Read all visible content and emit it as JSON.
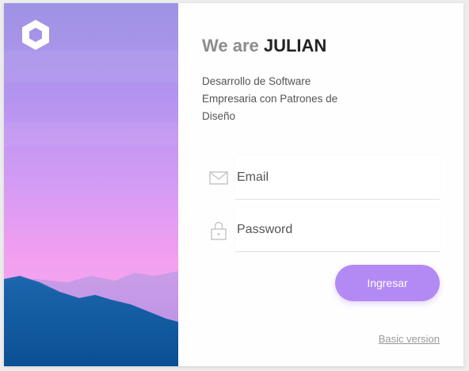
{
  "brand": {
    "logo_icon": "hexagon-ring-logo",
    "title_light": "We are",
    "title_strong": "JULIAN",
    "subtitle": "Desarrollo de Software Empresaria con Patrones de Diseño"
  },
  "form": {
    "email": {
      "placeholder": "Email",
      "value": "",
      "icon": "mail-icon"
    },
    "password": {
      "placeholder": "Password",
      "value": "",
      "icon": "lock-icon"
    },
    "submit_label": "Ingresar"
  },
  "footer": {
    "basic_version_label": "Basic version"
  },
  "colors": {
    "accent": "#b38af4",
    "title_light": "#8c8c8c",
    "title_strong": "#222222",
    "hero_top": "#a08ee6",
    "hero_bottom": "#f7a8ee",
    "mountains_front": "#0a5aa0"
  }
}
